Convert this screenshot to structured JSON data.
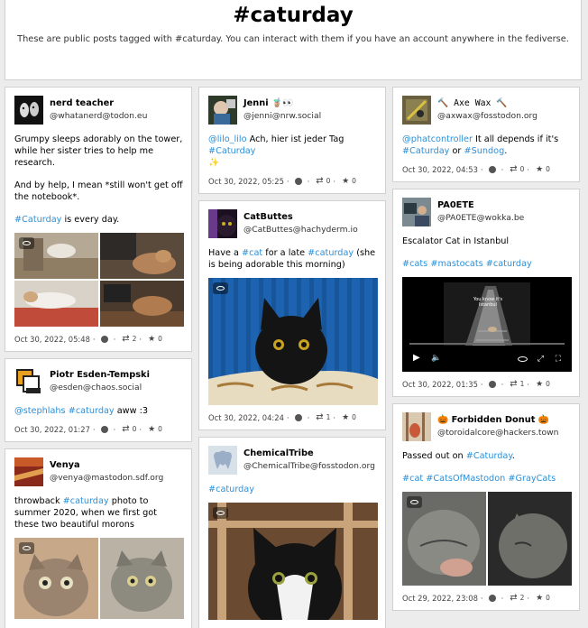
{
  "page": {
    "title": "#caturday",
    "description": "These are public posts tagged with #caturday. You can interact with them if you have an account anywhere in the fediverse."
  },
  "posts": {
    "nerd": {
      "name": "nerd teacher",
      "handle": "@whatanerd@todon.eu",
      "p1": "Grumpy sleeps adorably on the tower, while her sister tries to help me research.",
      "p2": "And by help, I mean *still won't get off the notebook*.",
      "tag": "#Caturday",
      "tail": " is every day.",
      "date": "Oct 30, 2022, 05:48",
      "boosts": "2",
      "favs": "0"
    },
    "piotr": {
      "name": "Piotr Esden-Tempski",
      "handle": "@esden@chaos.social",
      "mention": "@stephlahs",
      "tag": "#caturday",
      "tail": " aww :3",
      "date": "Oct 30, 2022, 01:27",
      "boosts": "0",
      "favs": "0"
    },
    "venya": {
      "name": "Venya",
      "handle": "@venya@mastodon.sdf.org",
      "pre": "throwback ",
      "tag": "#caturday",
      "tail": " photo to summer 2020, when we first got these two beautiful morons"
    },
    "jenni": {
      "name": "Jenni 🧋👀",
      "handle": "@jenni@nrw.social",
      "mention": "@lilo_lilo",
      "mid": " Ach, hier ist jeder Tag ",
      "tag": "#Caturday",
      "emoji": "✨",
      "date": "Oct 30, 2022, 05:25",
      "boosts": "0",
      "favs": "0"
    },
    "catbuttes": {
      "name": "CatButtes",
      "handle": "@CatButtes@hachyderm.io",
      "pre": "Have a ",
      "tag1": "#cat",
      "mid": " for a late ",
      "tag2": "#caturday",
      "tail": " (she is being adorable this morning)",
      "date": "Oct 30, 2022, 04:24",
      "boosts": "1",
      "favs": "0"
    },
    "chemical": {
      "name": "ChemicalTribe",
      "handle": "@ChemicalTribe@fosstodon.org",
      "tag": "#caturday"
    },
    "axe": {
      "name": "🔨 Axe Wax 🔨",
      "handle": "@axwax@fosstodon.org",
      "mention": "@phatcontroller",
      "mid": " It all depends if it's ",
      "tag1": "#Caturday",
      "or": " or ",
      "tag2": "#Sundog",
      "dot": ".",
      "date": "Oct 30, 2022, 04:53",
      "boosts": "0",
      "favs": "0"
    },
    "pa0ete": {
      "name": "PA0ETE",
      "handle": "@PA0ETE@wokka.be",
      "text": "Escalator Cat in Istanbul",
      "tag1": "#cats",
      "tag2": "#mastocats",
      "tag3": "#caturday",
      "video_caption": "You know it's Istanbul",
      "date": "Oct 30, 2022, 01:35",
      "boosts": "1",
      "favs": "0"
    },
    "donut": {
      "name": "🎃 Forbidden Donut 🎃",
      "handle": "@toroidalcore@hackers.town",
      "pre": "Passed out on ",
      "tag": "#Caturday",
      "dot": ".",
      "tag1": "#cat",
      "tag2": "#CatsOfMastodon",
      "tag3": "#GrayCats",
      "date": "Oct 29, 2022, 23:08",
      "boosts": "2",
      "favs": "0"
    }
  },
  "icons": {
    "visibility": "globe-icon",
    "boost": "boost-icon",
    "favourite": "star-icon",
    "sensitive": "eye-icon"
  },
  "colors": {
    "link": "#2b90d9",
    "background": "#ececec",
    "card": "#ffffff"
  }
}
